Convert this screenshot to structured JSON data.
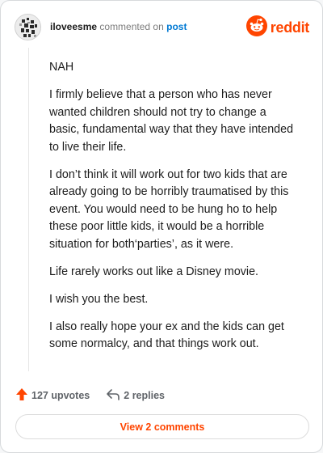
{
  "comment": {
    "username": "iloveesme",
    "action_text": "commented on",
    "post_link": "post",
    "brand": "reddit",
    "paragraphs": [
      "NAH",
      "I firmly believe that a person who has never wanted children should not try to change a basic, fundamental way that they have intended to live their life.",
      "I don’t think it will work out for two kids that are already going to be horribly traumatised by this event. You would need to be hung ho to help these poor little kids, it would be a horrible situation for both‘parties’, as it were.",
      "Life rarely works out like a Disney movie.",
      "I wish you the best.",
      "I also really hope your ex and the kids can get some normalcy, and that things work out."
    ],
    "upvotes_label": "127 upvotes",
    "replies_label": "2 replies",
    "view_comments_label": "View 2 comments"
  },
  "colors": {
    "accent": "#ff4500",
    "link": "#0079d3",
    "text": "#1c1c1c",
    "muted": "#7c7c7c"
  },
  "icons": {
    "avatar": "avatar-image",
    "brand": "reddit-snoo-icon",
    "upvote": "upvote-arrow-icon",
    "reply": "reply-arrow-icon"
  }
}
